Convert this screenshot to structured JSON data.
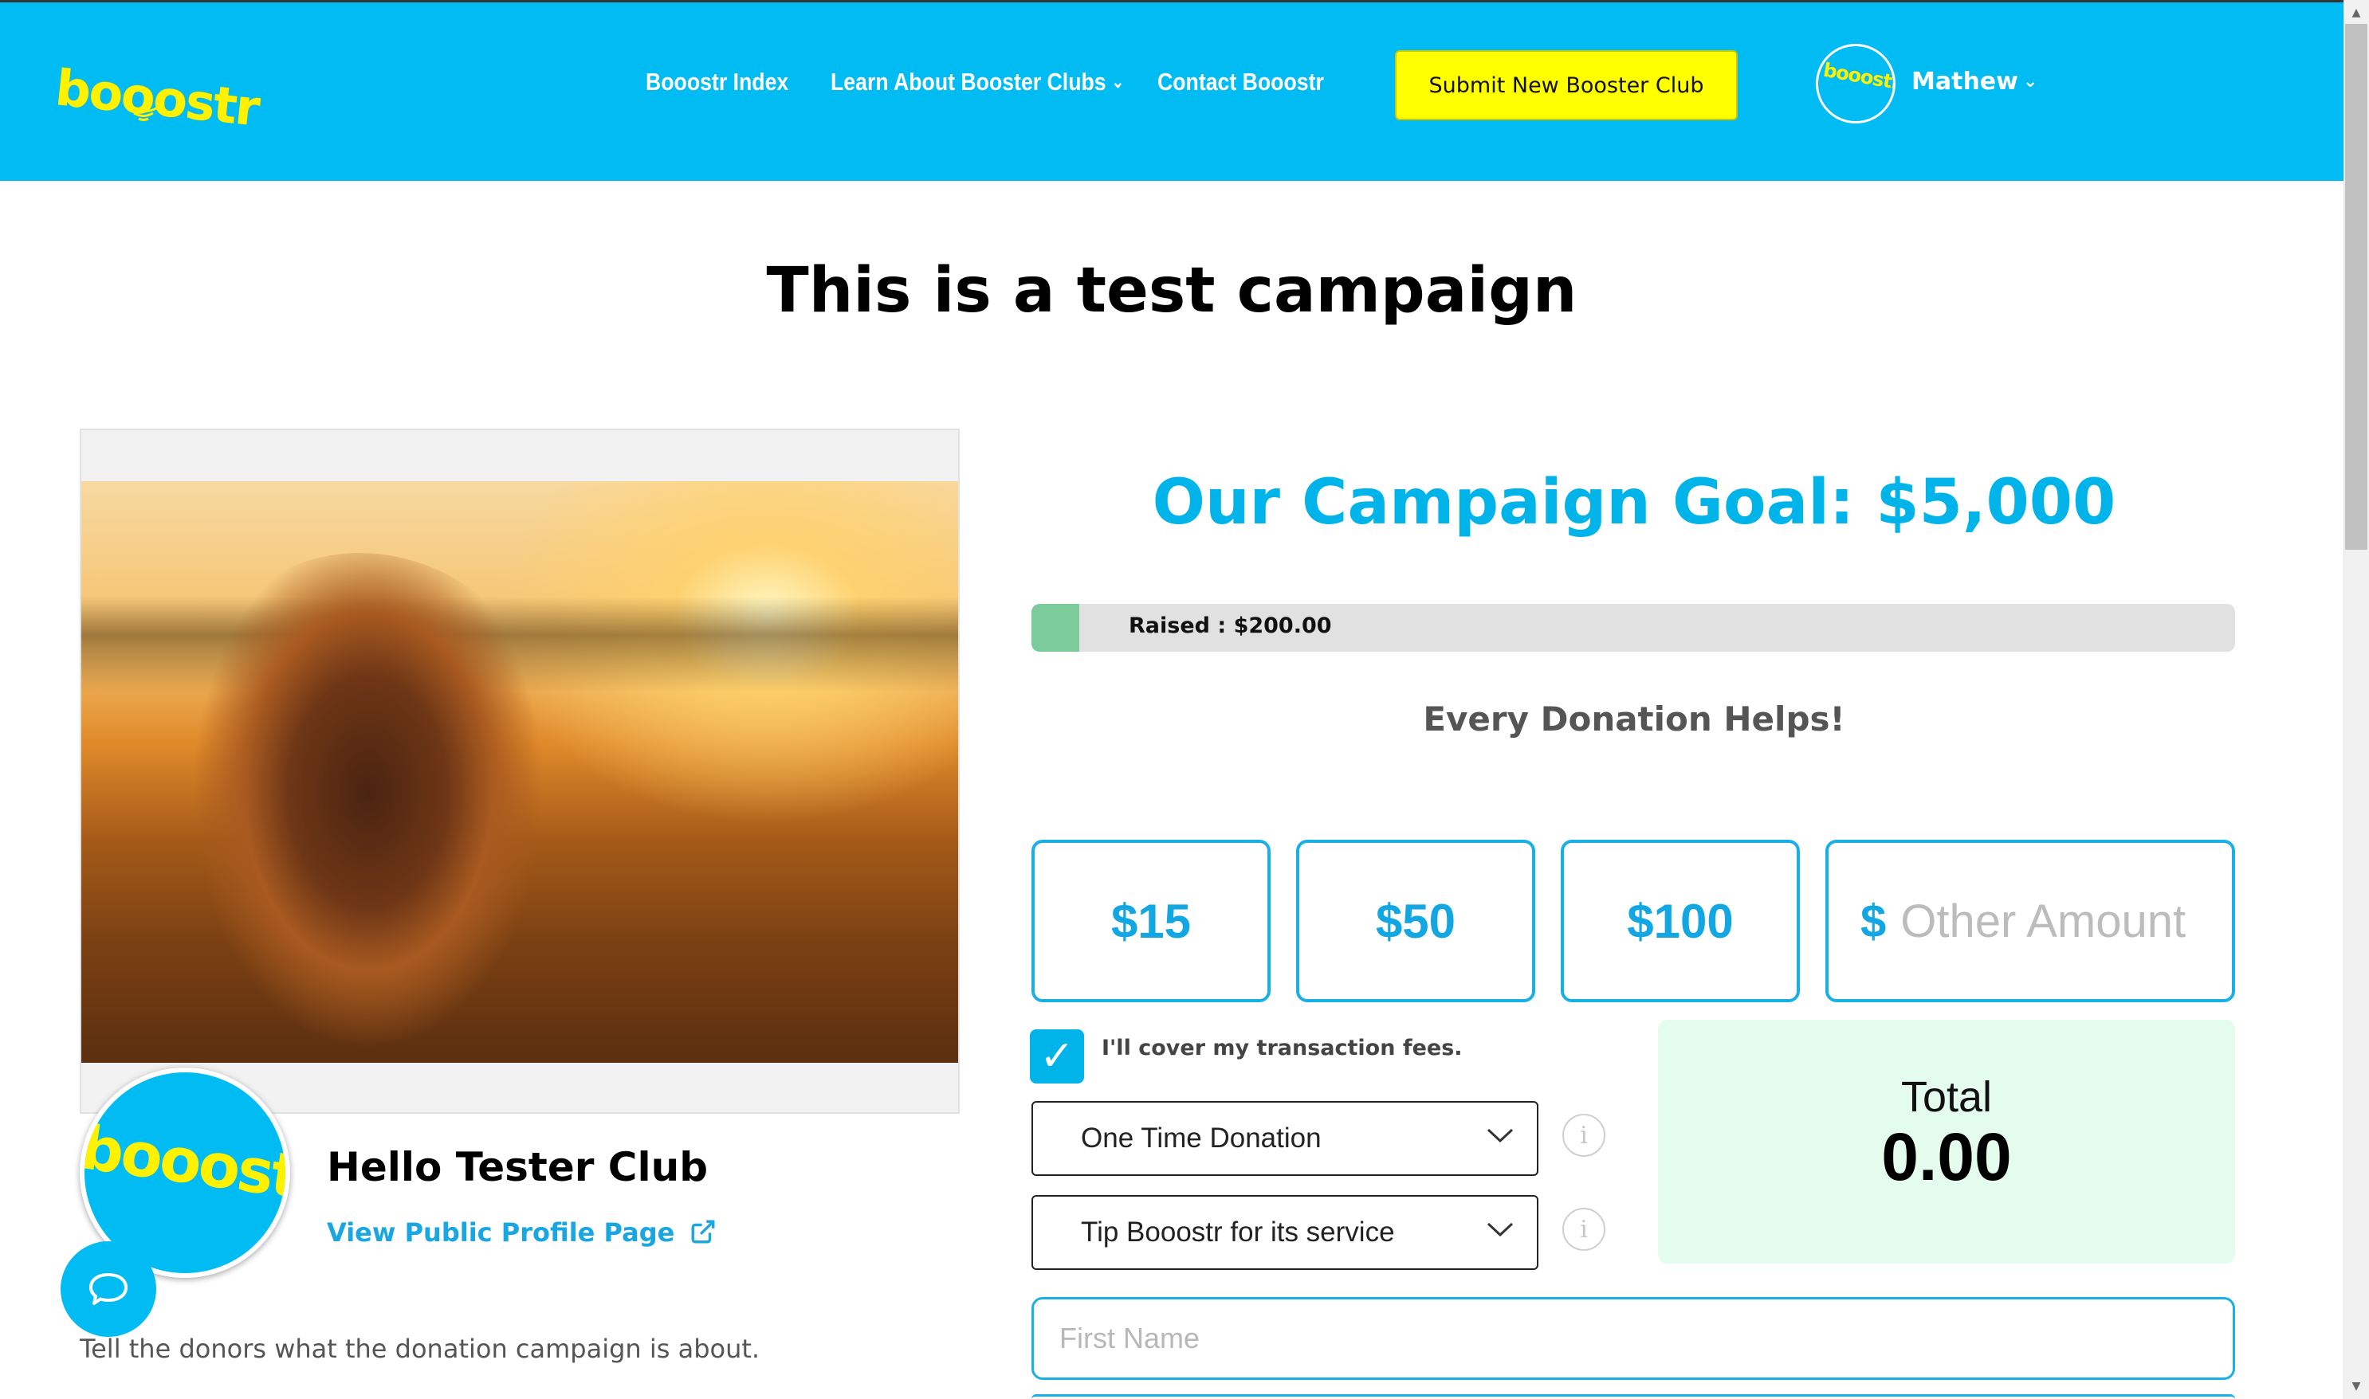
{
  "header": {
    "brand": "booostr",
    "nav": [
      {
        "label": "Booostr Index",
        "has_dropdown": false
      },
      {
        "label": "Learn About Booster Clubs",
        "has_dropdown": true
      },
      {
        "label": "Contact Booostr",
        "has_dropdown": false
      }
    ],
    "submit_button": "Submit New Booster Club",
    "user": {
      "name": "Mathew",
      "avatar_brand": "booostr"
    },
    "bg_color": "#00bcf2",
    "accent_yellow": "#ffff00"
  },
  "page": {
    "title": "This is a test campaign"
  },
  "club": {
    "avatar_brand": "booostr",
    "name": "Hello Tester Club",
    "profile_link": "View Public Profile Page",
    "description": "Tell the donors what the donation campaign is about."
  },
  "campaign": {
    "goal_text": "Our Campaign Goal: $5,000",
    "goal_amount": 5000,
    "raised_amount": 200,
    "raised_fraction": 0.04,
    "raised_label": "Raised : $200.00",
    "tagline": "Every Donation Helps!",
    "amounts": [
      "$15",
      "$50",
      "$100"
    ],
    "other_amount": {
      "currency": "$",
      "placeholder": "Other Amount"
    },
    "cover_fees": {
      "checked": true,
      "label": "I'll cover my transaction fees."
    },
    "frequency_select": "One Time Donation",
    "tip_select": "Tip Booostr for its service",
    "total": {
      "label": "Total",
      "value": "0.00"
    },
    "first_name_placeholder": "First Name",
    "accent_color": "#00b4ea",
    "progress_color": "#7ccb9a",
    "total_bg": "#e3fcee"
  },
  "icons": [
    "chevron-down-icon",
    "external-link-icon",
    "info-icon",
    "chat-icon",
    "checkmark-icon"
  ]
}
